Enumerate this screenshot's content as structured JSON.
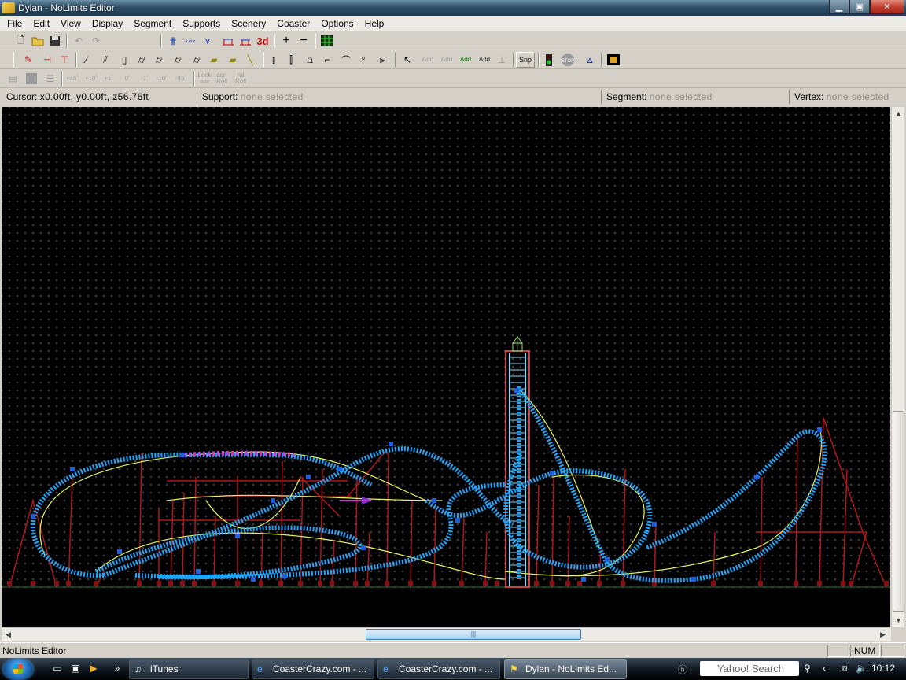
{
  "window": {
    "title": "Dylan - NoLimits Editor",
    "min_glyph": "▁",
    "max_glyph": "▣",
    "close_glyph": "✕"
  },
  "menu": [
    "File",
    "Edit",
    "View",
    "Display",
    "Segment",
    "Supports",
    "Scenery",
    "Coaster",
    "Options",
    "Help"
  ],
  "toolbar3": {
    "p45": "+45˚",
    "p10": "+10˚",
    "p1": "+1˚",
    "zero": "0˚",
    "m1": "-1˚",
    "m10": "-10˚",
    "m45": "-45˚",
    "lock": "Lock ∞∞",
    "con_roll": "con Roll",
    "rel_roll": "rel Roll"
  },
  "toolbar2": {
    "snp": "Snp",
    "stop": "STOP",
    "add1": "Add",
    "add2": "Add",
    "add3": "Add",
    "add4": "Add"
  },
  "toolbar1": {
    "label_3d": "3d"
  },
  "status": {
    "cursor_label": "Cursor:",
    "cursor_value": "x0.00ft, y0.00ft, z56.76ft",
    "support_label": "Support:",
    "support_value": "none selected",
    "segment_label": "Segment:",
    "segment_value": "none selected",
    "vertex_label": "Vertex:",
    "vertex_value": "none selected"
  },
  "app_status": {
    "text": "NoLimits Editor",
    "num": "NUM"
  },
  "taskbar": {
    "items": [
      {
        "label": "iTunes"
      },
      {
        "label": "CoasterCrazy.com - ..."
      },
      {
        "label": "CoasterCrazy.com - ..."
      },
      {
        "label": "Dylan - NoLimits Ed..."
      }
    ],
    "search": "Yahoo! Search",
    "time": "10:12",
    "chevron": "»"
  },
  "colors": {
    "track": "#1fa8ff",
    "rail": "#e8f560",
    "support": "#b0161a",
    "highlight": "#c83cd0",
    "tower_accent": "#ff5a5a",
    "ground": "#2f6b2f"
  }
}
